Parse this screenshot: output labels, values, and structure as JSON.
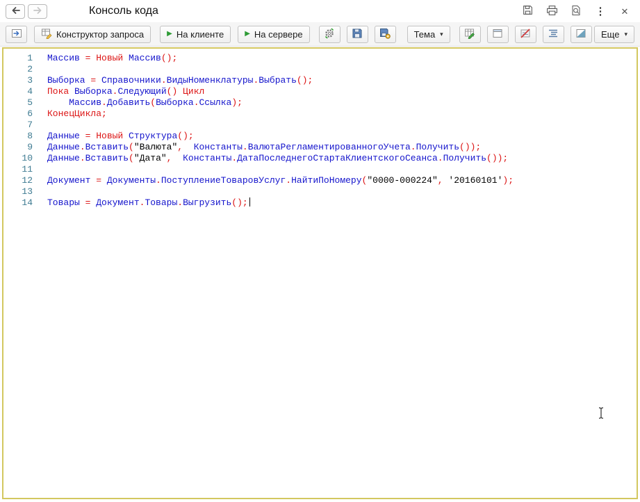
{
  "window": {
    "title": "Консоль кода"
  },
  "icons": {
    "menu": "⋮",
    "close": "✕",
    "play": "▶",
    "dropdown": "▾"
  },
  "toolbar": {
    "query_builder_label": "Конструктор запроса",
    "run_client_label": "На клиенте",
    "run_server_label": "На сервере",
    "theme_label": "Тема",
    "more_label": "Еще"
  },
  "editor": {
    "border_color": "#d3c75f",
    "gutter_color": "#3e7b92",
    "token_colors": {
      "id": "#1414cc",
      "kw": "#dc1414",
      "op": "#dc1414",
      "str": "#000000",
      "pl": "#000000"
    },
    "caret_line": 14,
    "lines": [
      {
        "n": "1",
        "t": [
          [
            "id",
            "Массив"
          ],
          [
            "op",
            " = "
          ],
          [
            "kw",
            "Новый"
          ],
          [
            "pl",
            " "
          ],
          [
            "id",
            "Массив"
          ],
          [
            "op",
            "();"
          ]
        ]
      },
      {
        "n": "2",
        "t": []
      },
      {
        "n": "3",
        "t": [
          [
            "id",
            "Выборка"
          ],
          [
            "op",
            " = "
          ],
          [
            "id",
            "Справочники"
          ],
          [
            "op",
            "."
          ],
          [
            "id",
            "ВидыНоменклатуры"
          ],
          [
            "op",
            "."
          ],
          [
            "id",
            "Выбрать"
          ],
          [
            "op",
            "();"
          ]
        ]
      },
      {
        "n": "4",
        "t": [
          [
            "kw",
            "Пока"
          ],
          [
            "pl",
            " "
          ],
          [
            "id",
            "Выборка"
          ],
          [
            "op",
            "."
          ],
          [
            "id",
            "Следующий"
          ],
          [
            "op",
            "()"
          ],
          [
            "pl",
            " "
          ],
          [
            "kw",
            "Цикл"
          ]
        ]
      },
      {
        "n": "5",
        "t": [
          [
            "pl",
            "    "
          ],
          [
            "id",
            "Массив"
          ],
          [
            "op",
            "."
          ],
          [
            "id",
            "Добавить"
          ],
          [
            "op",
            "("
          ],
          [
            "id",
            "Выборка"
          ],
          [
            "op",
            "."
          ],
          [
            "id",
            "Ссылка"
          ],
          [
            "op",
            ");"
          ]
        ]
      },
      {
        "n": "6",
        "t": [
          [
            "kw",
            "КонецЦикла"
          ],
          [
            "op",
            ";"
          ]
        ]
      },
      {
        "n": "7",
        "t": []
      },
      {
        "n": "8",
        "t": [
          [
            "id",
            "Данные"
          ],
          [
            "op",
            " = "
          ],
          [
            "kw",
            "Новый"
          ],
          [
            "pl",
            " "
          ],
          [
            "id",
            "Структура"
          ],
          [
            "op",
            "();"
          ]
        ]
      },
      {
        "n": "9",
        "t": [
          [
            "id",
            "Данные"
          ],
          [
            "op",
            "."
          ],
          [
            "id",
            "Вставить"
          ],
          [
            "op",
            "("
          ],
          [
            "str",
            "\"Валюта\""
          ],
          [
            "op",
            ","
          ],
          [
            "pl",
            "  "
          ],
          [
            "id",
            "Константы"
          ],
          [
            "op",
            "."
          ],
          [
            "id",
            "ВалютаРегламентированногоУчета"
          ],
          [
            "op",
            "."
          ],
          [
            "id",
            "Получить"
          ],
          [
            "op",
            "());"
          ]
        ]
      },
      {
        "n": "10",
        "t": [
          [
            "id",
            "Данные"
          ],
          [
            "op",
            "."
          ],
          [
            "id",
            "Вставить"
          ],
          [
            "op",
            "("
          ],
          [
            "str",
            "\"Дата\""
          ],
          [
            "op",
            ","
          ],
          [
            "pl",
            "  "
          ],
          [
            "id",
            "Константы"
          ],
          [
            "op",
            "."
          ],
          [
            "id",
            "ДатаПоследнегоСтартаКлиентскогоСеанса"
          ],
          [
            "op",
            "."
          ],
          [
            "id",
            "Получить"
          ],
          [
            "op",
            "());"
          ]
        ]
      },
      {
        "n": "11",
        "t": []
      },
      {
        "n": "12",
        "t": [
          [
            "id",
            "Документ"
          ],
          [
            "op",
            " = "
          ],
          [
            "id",
            "Документы"
          ],
          [
            "op",
            "."
          ],
          [
            "id",
            "ПоступлениеТоваровУслуг"
          ],
          [
            "op",
            "."
          ],
          [
            "id",
            "НайтиПоНомеру"
          ],
          [
            "op",
            "("
          ],
          [
            "str",
            "\"0000-000224\""
          ],
          [
            "op",
            ","
          ],
          [
            "pl",
            " "
          ],
          [
            "str",
            "'20160101'"
          ],
          [
            "op",
            ");"
          ]
        ]
      },
      {
        "n": "13",
        "t": []
      },
      {
        "n": "14",
        "t": [
          [
            "id",
            "Товары"
          ],
          [
            "op",
            " = "
          ],
          [
            "id",
            "Документ"
          ],
          [
            "op",
            "."
          ],
          [
            "id",
            "Товары"
          ],
          [
            "op",
            "."
          ],
          [
            "id",
            "Выгрузить"
          ],
          [
            "op",
            "();"
          ]
        ]
      }
    ]
  }
}
